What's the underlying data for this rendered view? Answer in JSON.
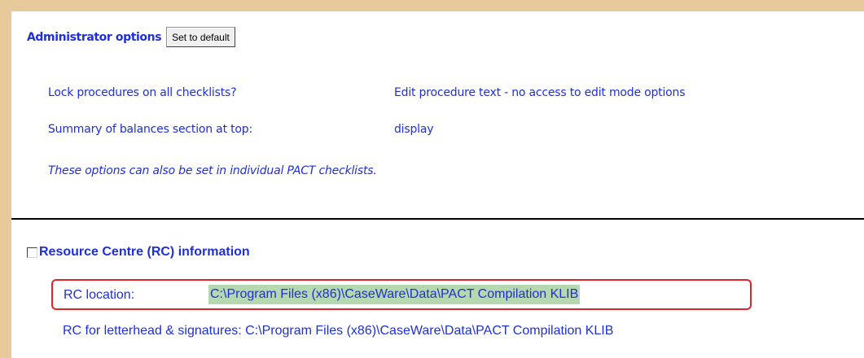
{
  "admin": {
    "title": "Administrator options",
    "default_button": "Set to default",
    "lock_label": "Lock procedures on all checklists?",
    "lock_value": "Edit procedure text - no access to edit mode options",
    "summary_label": "Summary of balances section at top:",
    "summary_value": "display",
    "note": "These options can also be set in individual PACT checklists."
  },
  "rc": {
    "checkbox_checked": false,
    "title": "Resource Centre (RC) information",
    "location_label": "RC location:",
    "location_value": "C:\\Program Files (x86)\\CaseWare\\Data\\PACT Compilation KLIB",
    "letterhead_label": "RC for letterhead & signatures:",
    "letterhead_value": "C:\\Program Files (x86)\\CaseWare\\Data\\PACT Compilation KLIB"
  },
  "colors": {
    "text_blue": "#1f2fd6",
    "page_background": "#e8c99b",
    "highlight_green": "#b6d8b0",
    "annotation_red": "#e0242a"
  }
}
